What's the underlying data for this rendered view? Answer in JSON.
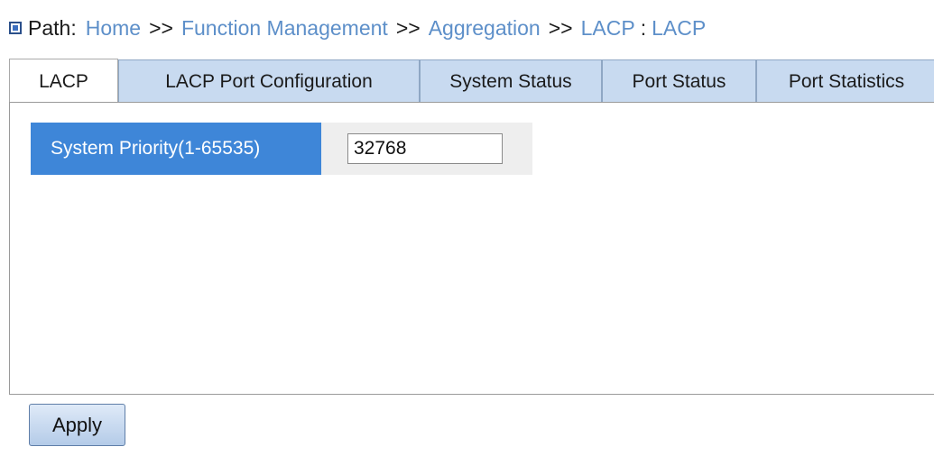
{
  "breadcrumb": {
    "label": "Path:",
    "items": [
      "Home",
      "Function Management",
      "Aggregation",
      "LACP",
      "LACP"
    ],
    "separator": ">>",
    "final_separator": ":"
  },
  "tabs": [
    {
      "label": "LACP",
      "active": true
    },
    {
      "label": "LACP Port Configuration",
      "active": false
    },
    {
      "label": "System Status",
      "active": false
    },
    {
      "label": "Port Status",
      "active": false
    },
    {
      "label": "Port Statistics",
      "active": false
    }
  ],
  "form": {
    "system_priority_label": "System Priority(1-65535)",
    "system_priority_value": "32768"
  },
  "actions": {
    "apply_label": "Apply"
  },
  "colors": {
    "link": "#5d8fc9",
    "label_bg": "#3e86d8",
    "tab_bg": "#c8daf0"
  }
}
